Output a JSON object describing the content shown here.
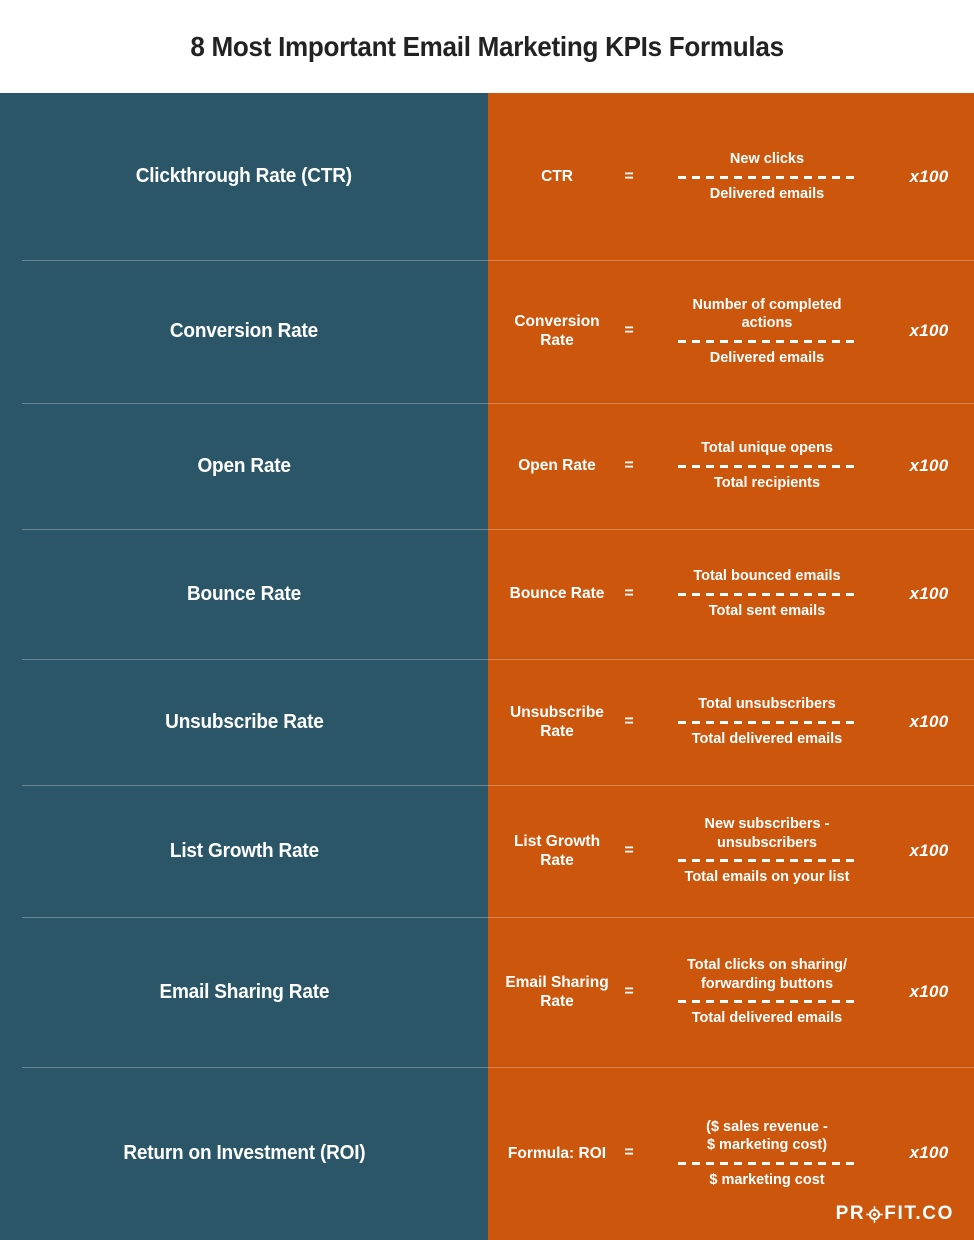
{
  "header": {
    "title": "8 Most Important Email Marketing KPIs Formulas"
  },
  "colors": {
    "teal": "#2A5668",
    "orange": "#CC560C",
    "title_text": "#222222",
    "text": "#FFFFFF",
    "divider": "rgba(255,255,255,0.28)"
  },
  "logo": {
    "part1": "PR",
    "icon": "target-icon",
    "part2": "FIT.CO",
    "full_text": "PROFIT.CO"
  },
  "table": {
    "multiplier_label": "x100",
    "equals_label": "=",
    "rows": [
      {
        "kpi": "Clickthrough Rate (CTR)",
        "formula_label": "CTR",
        "numerator": "New clicks",
        "denominator": "Delivered emails",
        "multiplier": "x100"
      },
      {
        "kpi": "Conversion Rate",
        "formula_label": "Conversion\nRate",
        "numerator": "Number of completed\nactions",
        "denominator": "Delivered emails",
        "multiplier": "x100"
      },
      {
        "kpi": "Open Rate",
        "formula_label": "Open Rate",
        "numerator": "Total unique opens",
        "denominator": "Total recipients",
        "multiplier": "x100"
      },
      {
        "kpi": "Bounce Rate",
        "formula_label": "Bounce Rate",
        "numerator": "Total bounced emails",
        "denominator": "Total sent emails",
        "multiplier": "x100"
      },
      {
        "kpi": "Unsubscribe Rate",
        "formula_label": "Unsubscribe\nRate",
        "numerator": "Total unsubscribers",
        "denominator": "Total delivered emails",
        "multiplier": "x100"
      },
      {
        "kpi": "List Growth Rate",
        "formula_label": "List Growth\nRate",
        "numerator": "New subscribers -\nunsubscribers",
        "denominator": "Total emails on your list",
        "multiplier": "x100"
      },
      {
        "kpi": "Email Sharing Rate",
        "formula_label": "Email Sharing\nRate",
        "numerator": "Total clicks on sharing/\nforwarding buttons",
        "denominator": "Total delivered emails",
        "multiplier": "x100"
      },
      {
        "kpi": "Return on Investment (ROI)",
        "formula_label": "Formula: ROI",
        "numerator": "($ sales revenue -\n$ marketing cost)",
        "denominator": "$ marketing cost",
        "multiplier": "x100"
      }
    ]
  }
}
